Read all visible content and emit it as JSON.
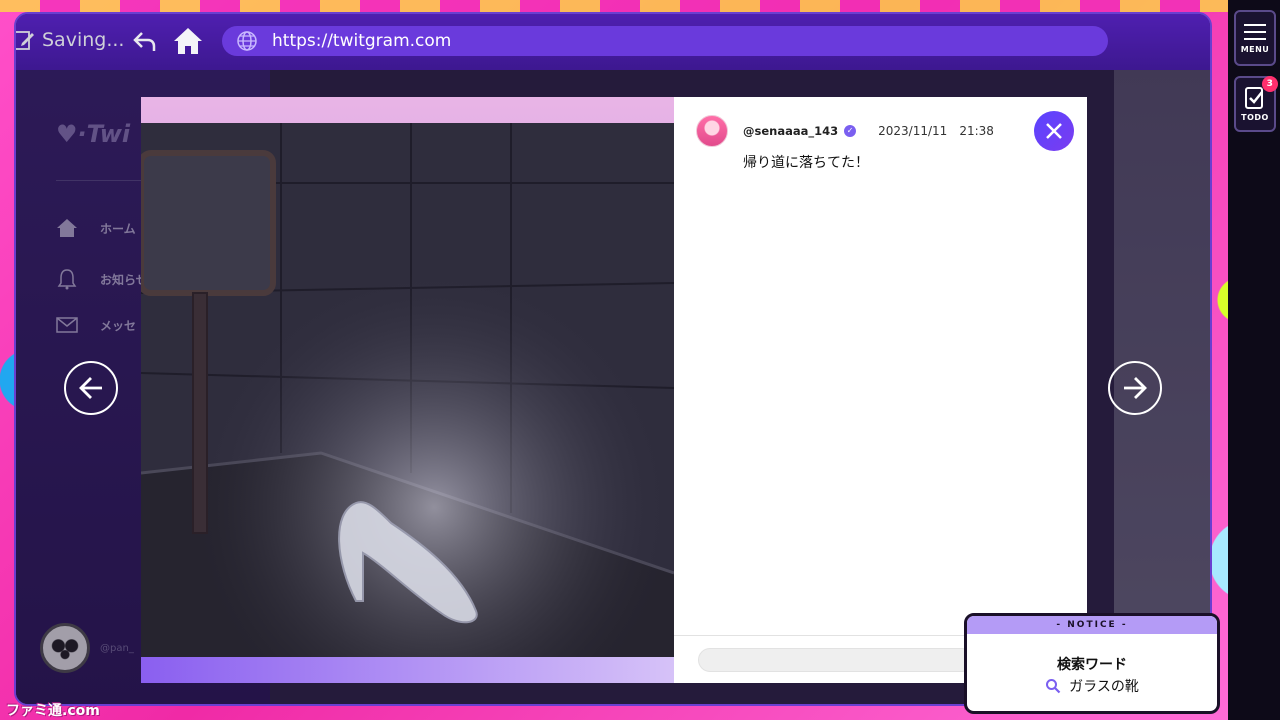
{
  "toolbar": {
    "saving_label": "Saving...",
    "url": "https://twitgram.com"
  },
  "rail": {
    "menu_label": "MENU",
    "todo_label": "TODO",
    "todo_count": "3"
  },
  "sidebar": {
    "logo": "Twi",
    "items": [
      {
        "label": "ホーム",
        "icon": "home-icon"
      },
      {
        "label": "お知らせ",
        "icon": "bell-icon"
      },
      {
        "label": "メッセ",
        "icon": "mail-icon"
      }
    ],
    "profile_handle": "@pan_"
  },
  "post": {
    "handle": "@senaaaa_143",
    "date": "2023/11/11",
    "time": "21:38",
    "text": "帰り道に落ちてた！"
  },
  "notice": {
    "header": "- NOTICE -",
    "title": "検索ワード",
    "term": "ガラスの靴"
  },
  "watermark": "ファミ通.com",
  "colors": {
    "accent": "#5a44ff",
    "toolbar": "#4f1fb0",
    "background": "#f22fb8"
  }
}
